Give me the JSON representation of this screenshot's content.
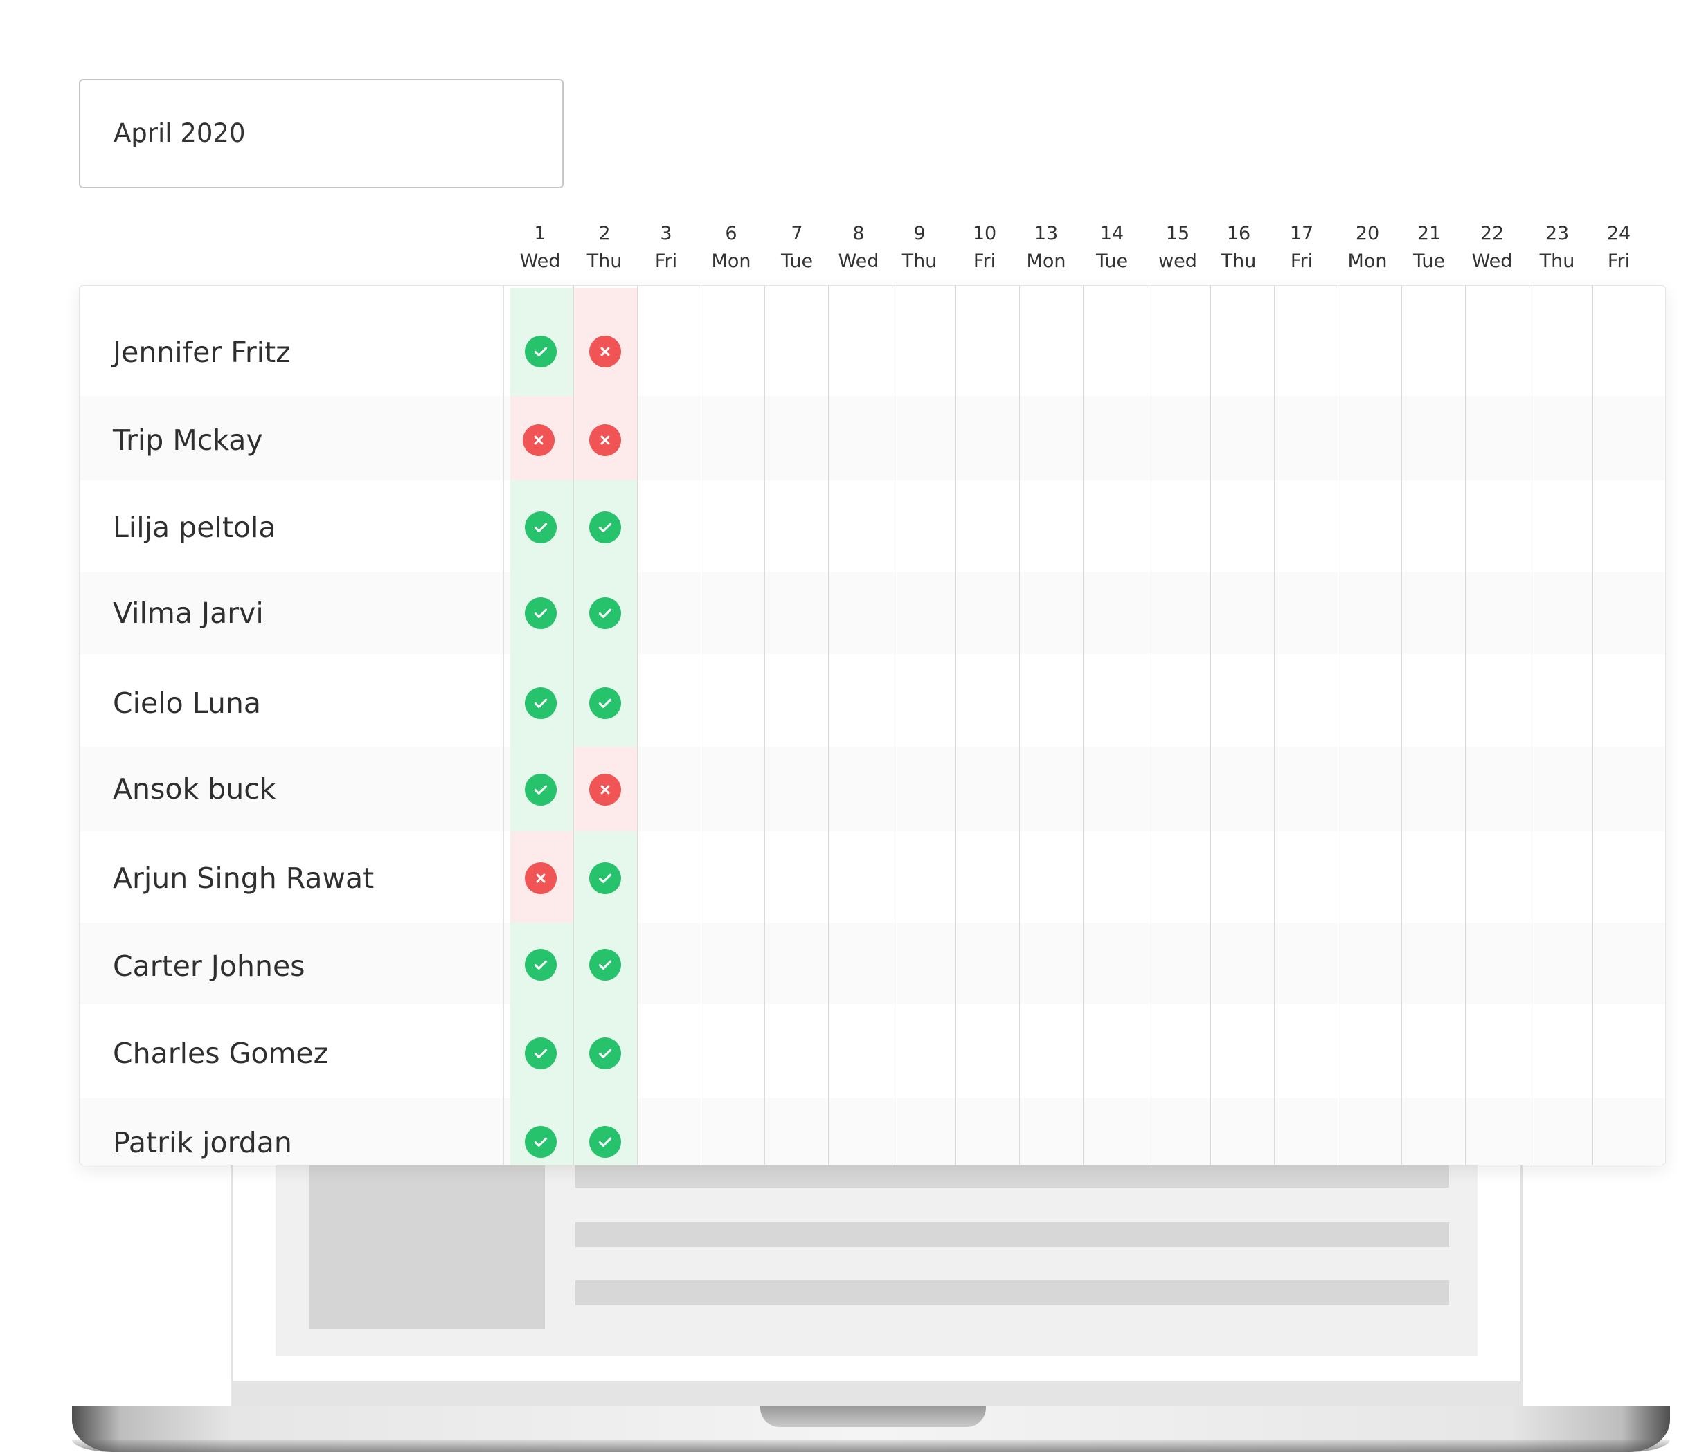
{
  "month": "April 2020",
  "days": [
    {
      "num": "1",
      "dow": "Wed"
    },
    {
      "num": "2",
      "dow": "Thu"
    },
    {
      "num": "3",
      "dow": "Fri"
    },
    {
      "num": "6",
      "dow": "Mon"
    },
    {
      "num": "7",
      "dow": "Tue"
    },
    {
      "num": "8",
      "dow": "Wed"
    },
    {
      "num": "9",
      "dow": "Thu"
    },
    {
      "num": "10",
      "dow": "Fri"
    },
    {
      "num": "13",
      "dow": "Mon"
    },
    {
      "num": "14",
      "dow": "Tue"
    },
    {
      "num": "15",
      "dow": "wed"
    },
    {
      "num": "16",
      "dow": "Thu"
    },
    {
      "num": "17",
      "dow": "Fri"
    },
    {
      "num": "20",
      "dow": "Mon"
    },
    {
      "num": "21",
      "dow": "Tue"
    },
    {
      "num": "22",
      "dow": "Wed"
    },
    {
      "num": "23",
      "dow": "Thu"
    },
    {
      "num": "24",
      "dow": "Fri"
    }
  ],
  "employees": [
    {
      "name": "Jennifer Fritz",
      "attendance": [
        "present",
        "absent"
      ]
    },
    {
      "name": "Trip Mckay",
      "attendance": [
        "absent",
        "absent"
      ]
    },
    {
      "name": "Lilja peltola",
      "attendance": [
        "present",
        "present"
      ]
    },
    {
      "name": "Vilma Jarvi",
      "attendance": [
        "present",
        "present"
      ]
    },
    {
      "name": "Cielo Luna",
      "attendance": [
        "present",
        "present"
      ]
    },
    {
      "name": "Ansok buck",
      "attendance": [
        "present",
        "absent"
      ]
    },
    {
      "name": "Arjun Singh Rawat",
      "attendance": [
        "absent",
        "present"
      ]
    },
    {
      "name": "Carter Johnes",
      "attendance": [
        "present",
        "present"
      ]
    },
    {
      "name": "Charles Gomez",
      "attendance": [
        "present",
        "present"
      ]
    },
    {
      "name": "Patrik jordan",
      "attendance": [
        "present",
        "present"
      ]
    }
  ],
  "icons": {
    "present": "check-circle-icon",
    "absent": "x-circle-icon"
  },
  "colors": {
    "present": "#27c26c",
    "absent": "#f05454",
    "present_tint": "#e6f8ec",
    "absent_tint": "#fdeaea"
  }
}
